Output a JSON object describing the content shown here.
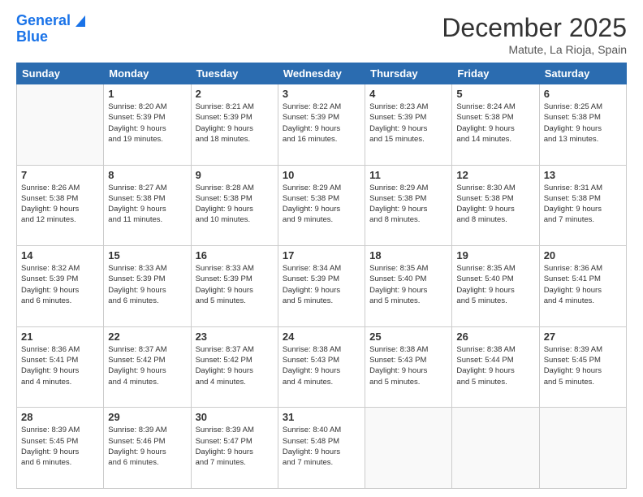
{
  "logo": {
    "line1": "General",
    "line2": "Blue"
  },
  "header": {
    "month_title": "December 2025",
    "subtitle": "Matute, La Rioja, Spain"
  },
  "days_of_week": [
    "Sunday",
    "Monday",
    "Tuesday",
    "Wednesday",
    "Thursday",
    "Friday",
    "Saturday"
  ],
  "weeks": [
    [
      {
        "day": "",
        "info": ""
      },
      {
        "day": "1",
        "info": "Sunrise: 8:20 AM\nSunset: 5:39 PM\nDaylight: 9 hours\nand 19 minutes."
      },
      {
        "day": "2",
        "info": "Sunrise: 8:21 AM\nSunset: 5:39 PM\nDaylight: 9 hours\nand 18 minutes."
      },
      {
        "day": "3",
        "info": "Sunrise: 8:22 AM\nSunset: 5:39 PM\nDaylight: 9 hours\nand 16 minutes."
      },
      {
        "day": "4",
        "info": "Sunrise: 8:23 AM\nSunset: 5:39 PM\nDaylight: 9 hours\nand 15 minutes."
      },
      {
        "day": "5",
        "info": "Sunrise: 8:24 AM\nSunset: 5:38 PM\nDaylight: 9 hours\nand 14 minutes."
      },
      {
        "day": "6",
        "info": "Sunrise: 8:25 AM\nSunset: 5:38 PM\nDaylight: 9 hours\nand 13 minutes."
      }
    ],
    [
      {
        "day": "7",
        "info": "Sunrise: 8:26 AM\nSunset: 5:38 PM\nDaylight: 9 hours\nand 12 minutes."
      },
      {
        "day": "8",
        "info": "Sunrise: 8:27 AM\nSunset: 5:38 PM\nDaylight: 9 hours\nand 11 minutes."
      },
      {
        "day": "9",
        "info": "Sunrise: 8:28 AM\nSunset: 5:38 PM\nDaylight: 9 hours\nand 10 minutes."
      },
      {
        "day": "10",
        "info": "Sunrise: 8:29 AM\nSunset: 5:38 PM\nDaylight: 9 hours\nand 9 minutes."
      },
      {
        "day": "11",
        "info": "Sunrise: 8:29 AM\nSunset: 5:38 PM\nDaylight: 9 hours\nand 8 minutes."
      },
      {
        "day": "12",
        "info": "Sunrise: 8:30 AM\nSunset: 5:38 PM\nDaylight: 9 hours\nand 8 minutes."
      },
      {
        "day": "13",
        "info": "Sunrise: 8:31 AM\nSunset: 5:38 PM\nDaylight: 9 hours\nand 7 minutes."
      }
    ],
    [
      {
        "day": "14",
        "info": "Sunrise: 8:32 AM\nSunset: 5:39 PM\nDaylight: 9 hours\nand 6 minutes."
      },
      {
        "day": "15",
        "info": "Sunrise: 8:33 AM\nSunset: 5:39 PM\nDaylight: 9 hours\nand 6 minutes."
      },
      {
        "day": "16",
        "info": "Sunrise: 8:33 AM\nSunset: 5:39 PM\nDaylight: 9 hours\nand 5 minutes."
      },
      {
        "day": "17",
        "info": "Sunrise: 8:34 AM\nSunset: 5:39 PM\nDaylight: 9 hours\nand 5 minutes."
      },
      {
        "day": "18",
        "info": "Sunrise: 8:35 AM\nSunset: 5:40 PM\nDaylight: 9 hours\nand 5 minutes."
      },
      {
        "day": "19",
        "info": "Sunrise: 8:35 AM\nSunset: 5:40 PM\nDaylight: 9 hours\nand 5 minutes."
      },
      {
        "day": "20",
        "info": "Sunrise: 8:36 AM\nSunset: 5:41 PM\nDaylight: 9 hours\nand 4 minutes."
      }
    ],
    [
      {
        "day": "21",
        "info": "Sunrise: 8:36 AM\nSunset: 5:41 PM\nDaylight: 9 hours\nand 4 minutes."
      },
      {
        "day": "22",
        "info": "Sunrise: 8:37 AM\nSunset: 5:42 PM\nDaylight: 9 hours\nand 4 minutes."
      },
      {
        "day": "23",
        "info": "Sunrise: 8:37 AM\nSunset: 5:42 PM\nDaylight: 9 hours\nand 4 minutes."
      },
      {
        "day": "24",
        "info": "Sunrise: 8:38 AM\nSunset: 5:43 PM\nDaylight: 9 hours\nand 4 minutes."
      },
      {
        "day": "25",
        "info": "Sunrise: 8:38 AM\nSunset: 5:43 PM\nDaylight: 9 hours\nand 5 minutes."
      },
      {
        "day": "26",
        "info": "Sunrise: 8:38 AM\nSunset: 5:44 PM\nDaylight: 9 hours\nand 5 minutes."
      },
      {
        "day": "27",
        "info": "Sunrise: 8:39 AM\nSunset: 5:45 PM\nDaylight: 9 hours\nand 5 minutes."
      }
    ],
    [
      {
        "day": "28",
        "info": "Sunrise: 8:39 AM\nSunset: 5:45 PM\nDaylight: 9 hours\nand 6 minutes."
      },
      {
        "day": "29",
        "info": "Sunrise: 8:39 AM\nSunset: 5:46 PM\nDaylight: 9 hours\nand 6 minutes."
      },
      {
        "day": "30",
        "info": "Sunrise: 8:39 AM\nSunset: 5:47 PM\nDaylight: 9 hours\nand 7 minutes."
      },
      {
        "day": "31",
        "info": "Sunrise: 8:40 AM\nSunset: 5:48 PM\nDaylight: 9 hours\nand 7 minutes."
      },
      {
        "day": "",
        "info": ""
      },
      {
        "day": "",
        "info": ""
      },
      {
        "day": "",
        "info": ""
      }
    ]
  ]
}
